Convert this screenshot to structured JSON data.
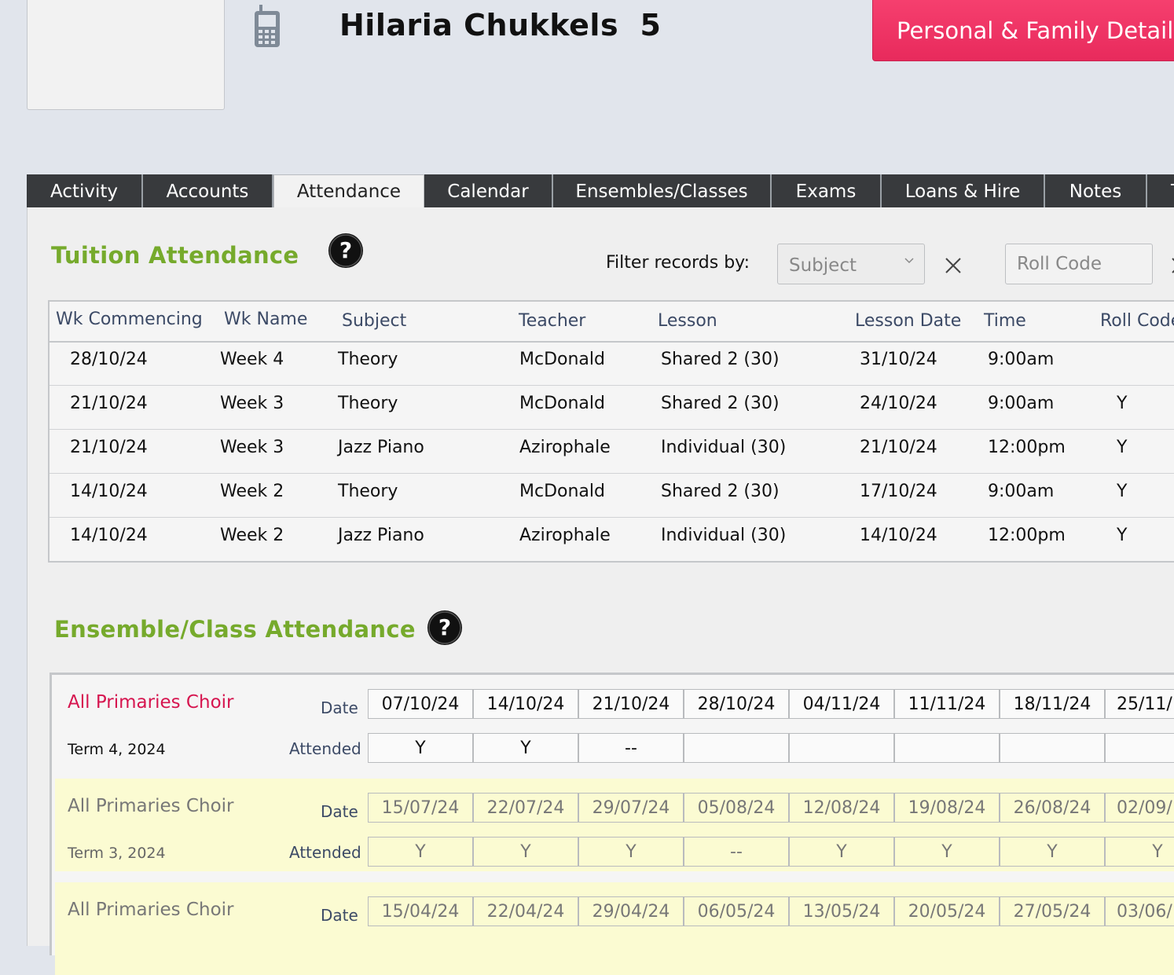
{
  "header": {
    "student_name": "Hilaria Chukkels  5",
    "family_button": "Personal & Family Details"
  },
  "tabs": [
    {
      "label": "Activity"
    },
    {
      "label": "Accounts"
    },
    {
      "label": "Attendance",
      "active": true
    },
    {
      "label": "Calendar"
    },
    {
      "label": "Ensembles/Classes"
    },
    {
      "label": "Exams"
    },
    {
      "label": "Loans & Hire"
    },
    {
      "label": "Notes"
    },
    {
      "label": "T"
    }
  ],
  "tuition": {
    "title": "Tuition Attendance",
    "filter_label": "Filter records by:",
    "subject_select": "Subject",
    "roll_code_placeholder": "Roll Code",
    "columns": [
      "Wk Commencing",
      "Wk Name",
      "Subject",
      "Teacher",
      "Lesson",
      "Lesson Date",
      "Time",
      "Roll Code"
    ],
    "rows": [
      [
        "28/10/24",
        "Week 4",
        "Theory",
        "McDonald",
        "Shared 2 (30)",
        "31/10/24",
        "9:00am",
        ""
      ],
      [
        "21/10/24",
        "Week 3",
        "Theory",
        "McDonald",
        "Shared 2 (30)",
        "24/10/24",
        "9:00am",
        "Y"
      ],
      [
        "21/10/24",
        "Week 3",
        "Jazz Piano",
        "Azirophale",
        "Individual (30)",
        "21/10/24",
        "12:00pm",
        "Y"
      ],
      [
        "14/10/24",
        "Week 2",
        "Theory",
        "McDonald",
        "Shared 2 (30)",
        "17/10/24",
        "9:00am",
        "Y"
      ],
      [
        "14/10/24",
        "Week 2",
        "Jazz Piano",
        "Azirophale",
        "Individual (30)",
        "14/10/24",
        "12:00pm",
        "Y"
      ]
    ]
  },
  "ensemble": {
    "title": "Ensemble/Class Attendance",
    "date_label": "Date",
    "attended_label": "Attended",
    "blocks": [
      {
        "name": "All Primaries Choir",
        "term": "Term 4, 2024",
        "dates": [
          "07/10/24",
          "14/10/24",
          "21/10/24",
          "28/10/24",
          "04/11/24",
          "11/11/24",
          "18/11/24",
          "25/11/"
        ],
        "attended": [
          "Y",
          "Y",
          "--",
          "",
          "",
          "",
          "",
          ""
        ]
      },
      {
        "name": "All Primaries Choir",
        "term": "Term 3, 2024",
        "dates": [
          "15/07/24",
          "22/07/24",
          "29/07/24",
          "05/08/24",
          "12/08/24",
          "19/08/24",
          "26/08/24",
          "02/09/"
        ],
        "attended": [
          "Y",
          "Y",
          "Y",
          "--",
          "Y",
          "Y",
          "Y",
          "Y"
        ]
      },
      {
        "name": "All Primaries Choir",
        "term": "",
        "dates": [
          "15/04/24",
          "22/04/24",
          "29/04/24",
          "06/05/24",
          "13/05/24",
          "20/05/24",
          "27/05/24",
          "03/06/"
        ],
        "attended": []
      }
    ]
  },
  "colors": {
    "section_title": "#76aa2c",
    "family_button": "#f0386a",
    "current_ensemble": "#d6154f",
    "past_block_bg": "#fbfbd2",
    "tab_dark": "#383a3d"
  }
}
